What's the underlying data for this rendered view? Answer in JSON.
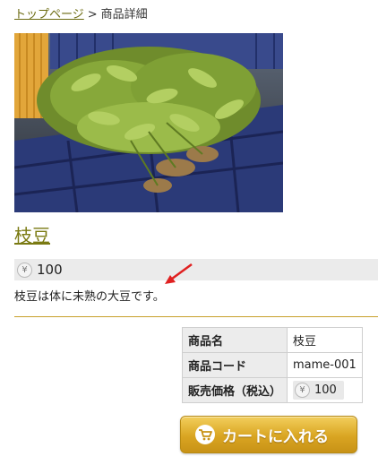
{
  "breadcrumb": {
    "home_label": "トップページ",
    "separator": ">",
    "current_label": "商品詳細"
  },
  "product": {
    "image_alt": "edamame-photo",
    "title": "枝豆",
    "price_symbol": "¥",
    "price": "100",
    "description": "枝豆は体に未熟の大豆です。"
  },
  "spec_table": {
    "rows": [
      {
        "label": "商品名",
        "value": "枝豆"
      },
      {
        "label": "商品コード",
        "value": "mame-001"
      },
      {
        "label": "販売価格（税込）",
        "value": "100"
      }
    ],
    "price_symbol": "¥"
  },
  "cart_button": {
    "label": "カートに入れる",
    "icon": "cart-icon"
  },
  "colors": {
    "link": "#6b6a10",
    "title": "#7a7a12",
    "divider": "#c8a02a",
    "button": "#d9a522",
    "annotation_arrow": "#e02020"
  }
}
